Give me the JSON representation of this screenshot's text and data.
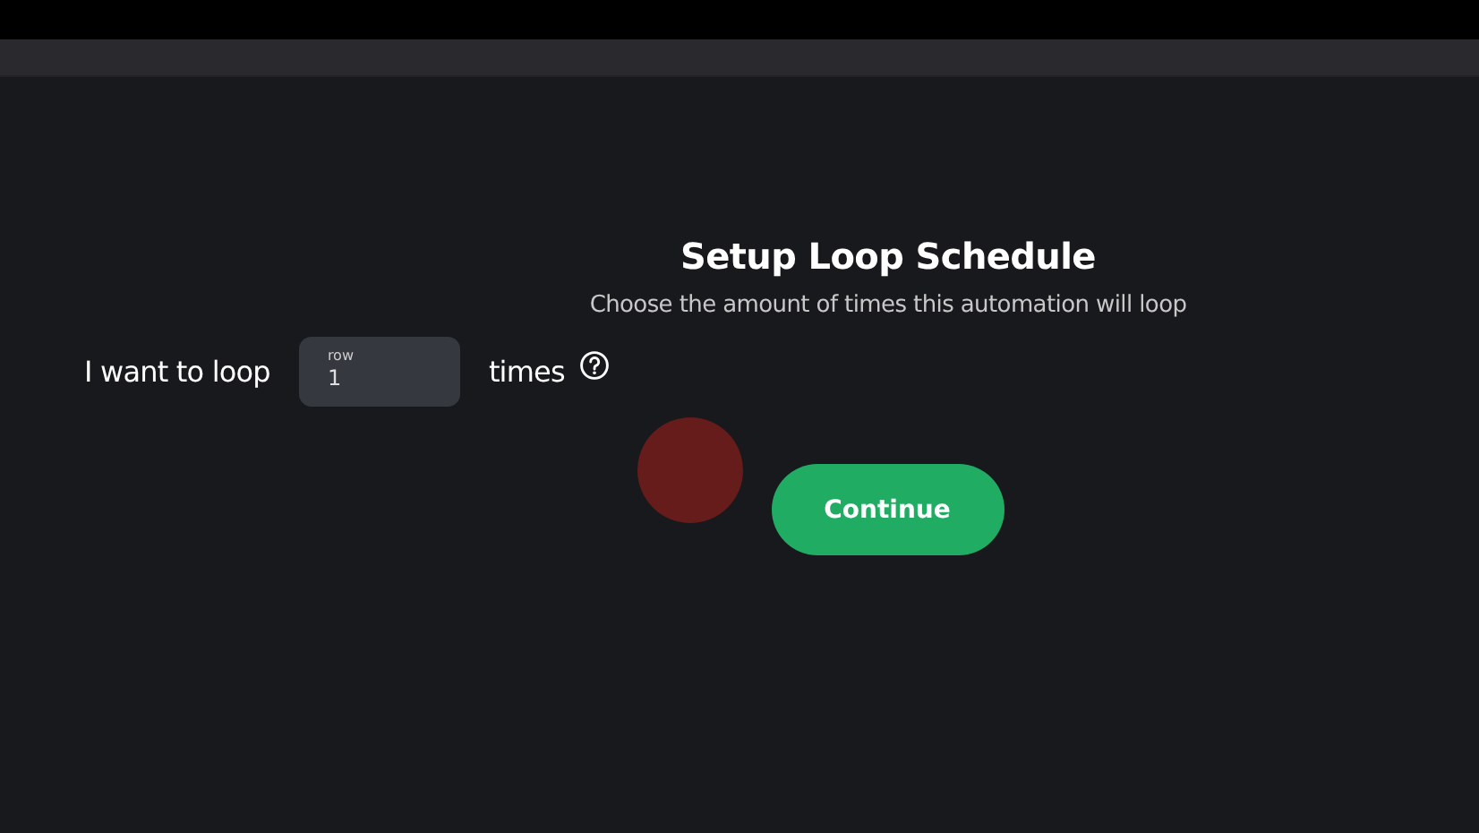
{
  "title": "Setup Loop Schedule",
  "subtitle": "Choose the amount of times this automation will loop",
  "loop_row": {
    "prefix": "I want to loop",
    "field": {
      "label": "row",
      "value": "1"
    },
    "suffix": "times"
  },
  "buttons": [
    {
      "label": "Continue",
      "kind": "primary"
    }
  ]
}
